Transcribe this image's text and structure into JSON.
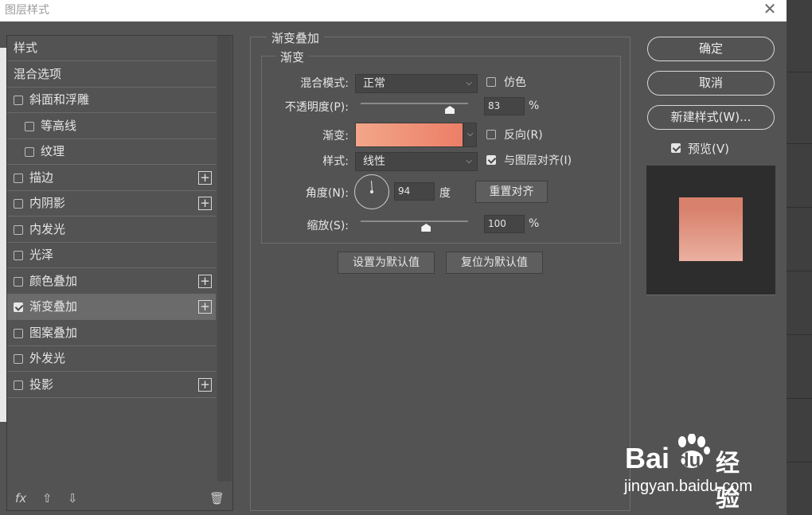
{
  "window": {
    "title": "图层样式",
    "close_symbol": "✕"
  },
  "sidebar": {
    "items": [
      {
        "label": "样式",
        "checkbox": false,
        "checked": false,
        "plus": false
      },
      {
        "label": "混合选项",
        "checkbox": false,
        "checked": false,
        "plus": false
      },
      {
        "label": "斜面和浮雕",
        "checkbox": true,
        "checked": false,
        "plus": false
      },
      {
        "label": "等高线",
        "checkbox": true,
        "checked": false,
        "plus": false,
        "indent": true
      },
      {
        "label": "纹理",
        "checkbox": true,
        "checked": false,
        "plus": false,
        "indent": true
      },
      {
        "label": "描边",
        "checkbox": true,
        "checked": false,
        "plus": true
      },
      {
        "label": "内阴影",
        "checkbox": true,
        "checked": false,
        "plus": true
      },
      {
        "label": "内发光",
        "checkbox": true,
        "checked": false,
        "plus": false
      },
      {
        "label": "光泽",
        "checkbox": true,
        "checked": false,
        "plus": false
      },
      {
        "label": "颜色叠加",
        "checkbox": true,
        "checked": false,
        "plus": true
      },
      {
        "label": "渐变叠加",
        "checkbox": true,
        "checked": true,
        "plus": true,
        "selected": true
      },
      {
        "label": "图案叠加",
        "checkbox": true,
        "checked": false,
        "plus": false
      },
      {
        "label": "外发光",
        "checkbox": true,
        "checked": false,
        "plus": false
      },
      {
        "label": "投影",
        "checkbox": true,
        "checked": false,
        "plus": true
      }
    ],
    "bottom": {
      "fx": "fx",
      "up": "⇧",
      "down": "⇩",
      "trash": "🗑"
    }
  },
  "panel": {
    "group_title": "渐变叠加",
    "subgroup_title": "渐变",
    "blend_mode_label": "混合模式:",
    "blend_mode_value": "正常",
    "dither_label": "仿色",
    "dither_checked": false,
    "opacity_label": "不透明度(P):",
    "opacity_value": "83",
    "opacity_unit": "%",
    "opacity_fraction": 0.83,
    "gradient_label": "渐变:",
    "gradient_colors": [
      "#f2a68a",
      "#ec7e66"
    ],
    "reverse_label": "反向(R)",
    "reverse_checked": false,
    "style_label": "样式:",
    "style_value": "线性",
    "align_label": "与图层对齐(I)",
    "align_checked": true,
    "angle_label": "角度(N):",
    "angle_value": "94",
    "angle_unit": "度",
    "reset_align_label": "重置对齐",
    "scale_label": "缩放(S):",
    "scale_value": "100",
    "scale_unit": "%",
    "set_default_label": "设置为默认值",
    "reset_default_label": "复位为默认值"
  },
  "actions": {
    "ok_label": "确定",
    "cancel_label": "取消",
    "new_style_label": "新建样式(W)...",
    "preview_label": "预览(V)",
    "preview_checked": true
  },
  "preview": {
    "top_color": "#d8826e",
    "bottom_color": "#ebb0a0"
  },
  "watermark": {
    "brand": "Bai",
    "brand2": "du",
    "brand_cn": "经验",
    "url": "jingyan.baidu.com"
  }
}
